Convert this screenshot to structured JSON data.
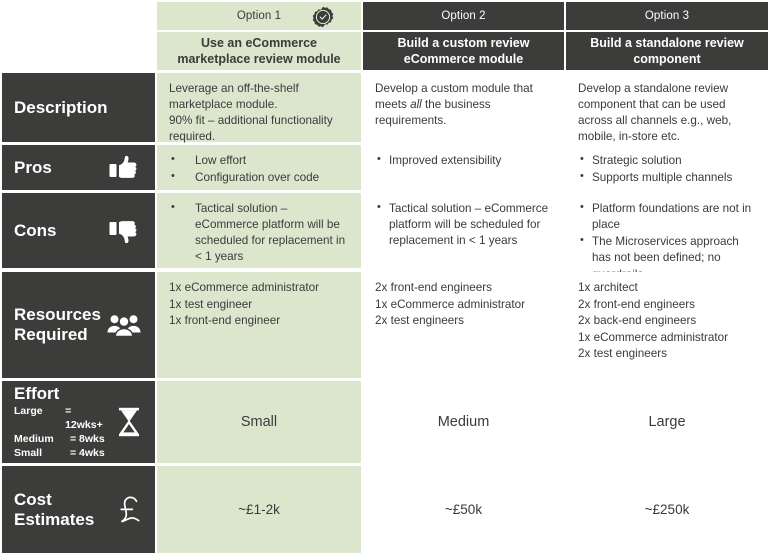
{
  "theme": {
    "dark": "#3c3c3b",
    "green": "#dce6cc",
    "white": "#ffffff",
    "text_dark": "#3b3b3b",
    "text_light": "#ffffff"
  },
  "columns": [
    {
      "id": "option-1",
      "option_label": "Option 1",
      "title": "Use an eCommerce marketplace review module",
      "recommended": true,
      "badge_icon": "recommended-check-badge-icon",
      "highlighted": true
    },
    {
      "id": "option-2",
      "option_label": "Option 2",
      "title": "Build a custom review eCommerce module",
      "recommended": false,
      "highlighted": false
    },
    {
      "id": "option-3",
      "option_label": "Option 3",
      "title": "Build a standalone review component",
      "recommended": false,
      "highlighted": false
    }
  ],
  "rows": {
    "description": {
      "label": "Description",
      "icon": null,
      "option1": {
        "lines": [
          "Leverage an off-the-shelf",
          "marketplace module.",
          "90% fit – additional functionality",
          "required."
        ],
        "text": "Leverage an off-the-shelf marketplace module. 90% fit – additional functionality required."
      },
      "option2": {
        "text_before_italic": "Develop a custom module that meets ",
        "italic": "all",
        "text_after_italic": " the business requirements.",
        "text": "Develop a custom module that meets all the business requirements."
      },
      "option3": {
        "text": "Develop a standalone review component that can be used across all channels e.g., web, mobile, in-store etc."
      }
    },
    "pros": {
      "label": "Pros",
      "icon": "thumbs-up-icon",
      "option1": [
        "Low effort",
        "Configuration over code"
      ],
      "option2": [
        "Improved extensibility"
      ],
      "option3": [
        "Strategic solution",
        "Supports multiple channels"
      ]
    },
    "cons": {
      "label": "Cons",
      "icon": "thumbs-down-icon",
      "option1": [
        "Tactical solution – eCommerce platform will be scheduled for replacement in < 1 years"
      ],
      "option2": [
        "Tactical solution – eCommerce platform will be scheduled for replacement in < 1 years"
      ],
      "option3": [
        "Platform foundations are not in place",
        "The Microservices approach has not been defined; no guardrails."
      ]
    },
    "resources_required": {
      "label": "Resources Required",
      "label_line1": "Resources",
      "label_line2": "Required",
      "icon": "people-group-icon",
      "option1": [
        "1x eCommerce administrator",
        "1x test engineer",
        "1x front-end engineer"
      ],
      "option2": [
        "2x front-end engineers",
        "1x eCommerce administrator",
        "2x test engineers"
      ],
      "option3": [
        "1x architect",
        "2x front-end engineers",
        "2x back-end engineers",
        "1x eCommerce administrator",
        "2x test engineers"
      ]
    },
    "effort": {
      "label": "Effort",
      "icon": "hourglass-icon",
      "legend": [
        {
          "key": "Large",
          "value": "= 12wks+"
        },
        {
          "key": "Medium",
          "value": "= 8wks"
        },
        {
          "key": "Small",
          "value": "= 4wks"
        }
      ],
      "option1": "Small",
      "option2": "Medium",
      "option3": "Large"
    },
    "cost_estimates": {
      "label": "Cost Estimates",
      "icon": "pound-sterling-icon",
      "option1": "~£1-2k",
      "option2": "~£50k",
      "option3": "~£250k"
    }
  }
}
